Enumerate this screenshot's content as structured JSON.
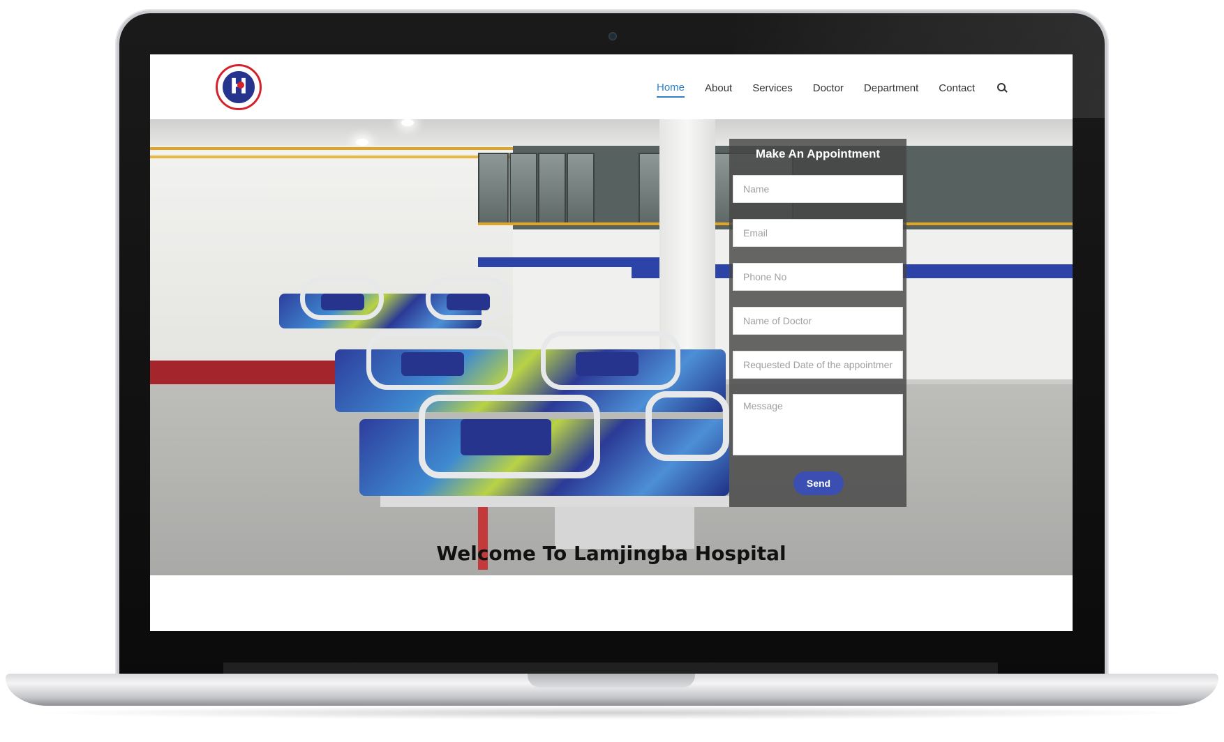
{
  "brand": {
    "logo_letter": "H",
    "primary_color": "#26348d",
    "accent_color": "#d4222b",
    "link_active_color": "#2f80c9"
  },
  "nav": {
    "items": [
      {
        "label": "Home",
        "active": true
      },
      {
        "label": "About"
      },
      {
        "label": "Services"
      },
      {
        "label": "Doctor"
      },
      {
        "label": "Department"
      },
      {
        "label": "Contact"
      }
    ],
    "search_icon": "search-icon"
  },
  "appointment": {
    "title": "Make An Appointment",
    "fields": {
      "name_placeholder": "Name",
      "email_placeholder": "Email",
      "phone_placeholder": "Phone No",
      "doctor_placeholder": "Name of Doctor",
      "date_placeholder": "Requested Date of the appointmen",
      "message_placeholder": "Message"
    },
    "send_label": "Send",
    "send_color": "#3b4fb3"
  },
  "welcome": {
    "heading": "Welcome To Lamjingba Hospital"
  }
}
